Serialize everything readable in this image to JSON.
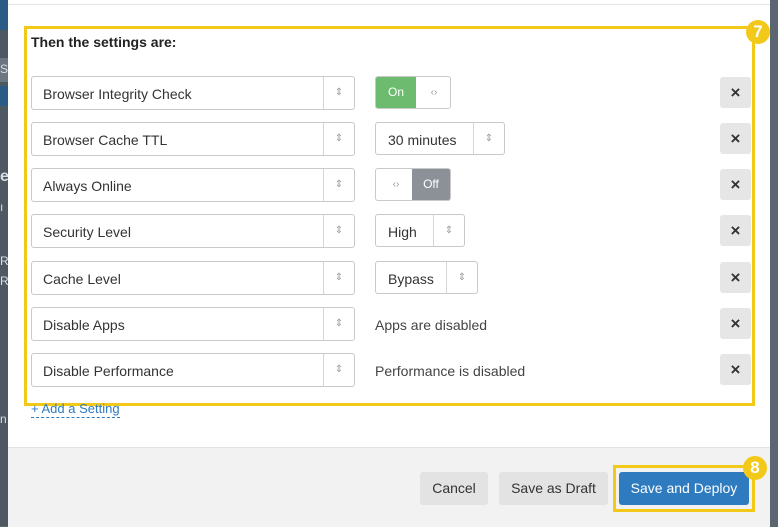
{
  "rule_settings": {
    "heading": "Then the settings are:",
    "badge": "7",
    "rows": [
      {
        "setting": "Browser Integrity Check",
        "control": "toggle",
        "state": "On",
        "on_label": "On",
        "off_label": "Off",
        "grip": "‹›"
      },
      {
        "setting": "Browser Cache TTL",
        "control": "select",
        "value": "30 minutes"
      },
      {
        "setting": "Always Online",
        "control": "toggle",
        "state": "Off",
        "on_label": "On",
        "off_label": "Off",
        "grip": "‹›"
      },
      {
        "setting": "Security Level",
        "control": "select",
        "value": "High"
      },
      {
        "setting": "Cache Level",
        "control": "select",
        "value": "Bypass"
      },
      {
        "setting": "Disable Apps",
        "control": "text",
        "value": "Apps are disabled"
      },
      {
        "setting": "Disable Performance",
        "control": "text",
        "value": "Performance is disabled"
      }
    ],
    "remove_label": "×",
    "select_arrow": "⇕"
  },
  "add_setting_label": "+ Add a Setting",
  "footer": {
    "cancel_label": "Cancel",
    "save_draft_label": "Save as Draft",
    "save_deploy_label": "Save and Deploy",
    "deploy_badge": "8"
  },
  "background_fragments": [
    "S",
    "e",
    "ı",
    "R",
    "R",
    "n"
  ],
  "colors": {
    "highlight": "#f2c919",
    "toggle_on": "#6cbb6e",
    "toggle_off": "#8b9197",
    "primary": "#2f7bbf"
  }
}
